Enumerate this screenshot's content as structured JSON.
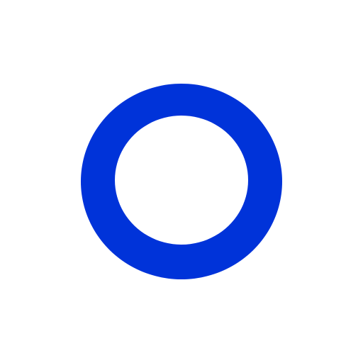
{
  "logo": {
    "icon": "ring-icon",
    "ring_color": "#0033D9",
    "background_color": "#FFFFFF"
  }
}
